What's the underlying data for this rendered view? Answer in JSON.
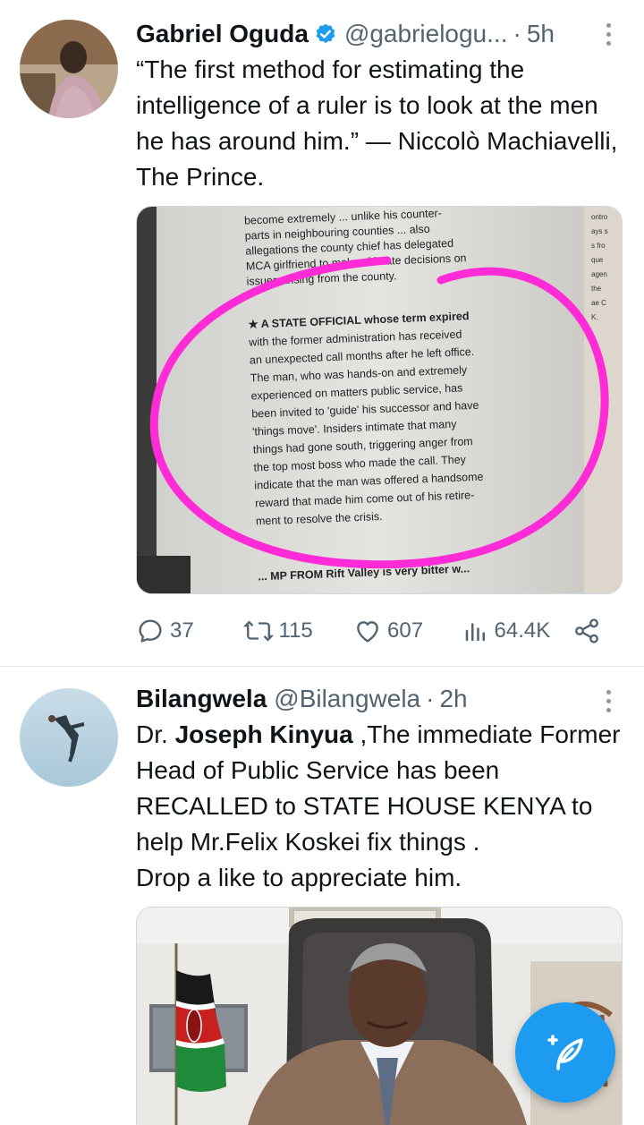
{
  "tweets": [
    {
      "author_name": "Gabriel Oguda",
      "handle": "@gabrielogu...",
      "time": "5h",
      "verified": true,
      "text": "“The first method for estimating the intelligence of a ruler is to look at the men he has around him.” — Niccolò Machiavelli, The Prince.",
      "media_alt": "Newspaper clipping with a pink circle",
      "clipping_lines": [
        "become extremely ... unlike his counter-",
        "parts in neighbouring counties ... also",
        "allegations the county chief has delegated",
        "MCA girlfriend to make ultimate decisions on",
        "issues arising from the county.",
        "★ A STATE OFFICIAL whose term expired",
        "with the former administration has received",
        "an unexpected call months after he left office.",
        "The man, who was hands-on and extremely",
        "experienced on matters public service, has",
        "been invited to 'guide' his successor and have",
        "'things move'. Insiders intimate that many",
        "things had gone south, triggering anger from",
        "the top most boss who made the call. They",
        "indicate that the man was offered a handsome",
        "reward that made him come out of his retire-",
        "ment to resolve the crisis.",
        "... MP FROM Rift Valley is very bitter w..."
      ],
      "stats": {
        "replies": "37",
        "retweets": "115",
        "likes": "607",
        "views": "64.4K"
      }
    },
    {
      "author_name": "Bilangwela",
      "handle": "@Bilangwela",
      "time": "2h",
      "verified": false,
      "text_prefix": "Dr. ",
      "text_bold": "Joseph Kinyua",
      "text_rest": " ,The immediate Former Head of Public Service has been RECALLED to STATE HOUSE KENYA to help Mr.Felix Koskei fix things .",
      "text_line2": "Drop a like to appreciate him.",
      "media_alt": "Photo of a man in a suit next to the Kenyan flag"
    }
  ],
  "colors": {
    "accent": "#1d9bf0",
    "secondary_text": "#536471",
    "circle_highlight": "#ff2bd6"
  },
  "icons": {
    "reply": "speech-bubble-icon",
    "retweet": "retweet-arrows-icon",
    "like": "heart-icon",
    "views": "bar-chart-icon",
    "share": "share-nodes-icon",
    "compose": "feather-plus-icon"
  }
}
